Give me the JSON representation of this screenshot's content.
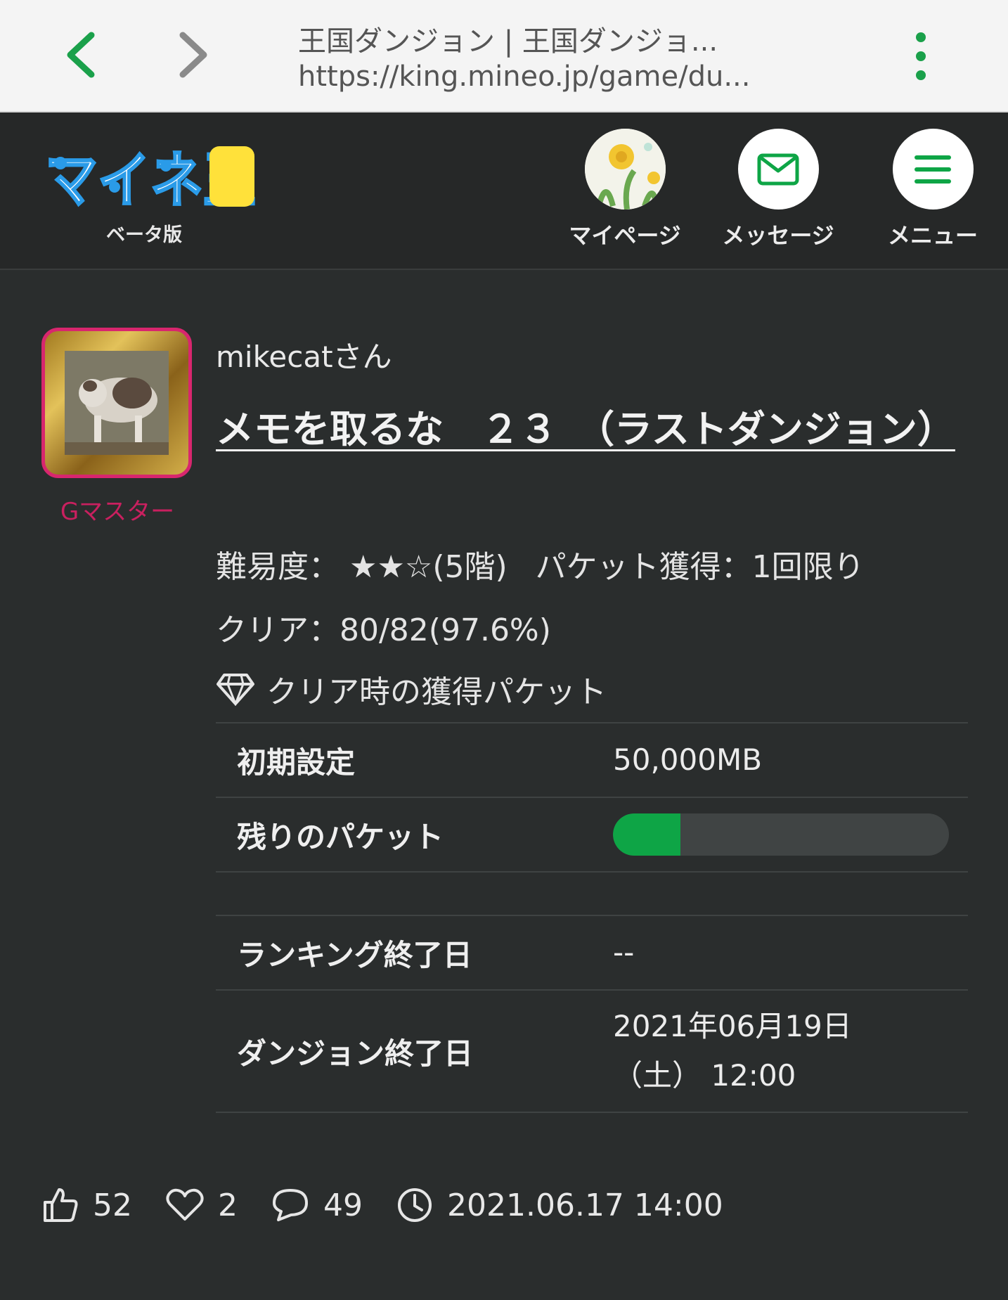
{
  "browser": {
    "page_title": "王国ダンジョン | 王国ダンジョ...",
    "url": "https://king.mineo.jp/game/du..."
  },
  "header": {
    "logo_text": "マイネ王",
    "beta_label": "ベータ版",
    "mypage_label": "マイページ",
    "message_label": "メッセージ",
    "menu_label": "メニュー"
  },
  "post": {
    "username": "mikecatさん",
    "rank": "Gマスター",
    "title": "メモを取るな　２３　（ラストダンジョン）",
    "difficulty_label": "難易度：",
    "difficulty_stars_filled": 2,
    "difficulty_stars_total": 3,
    "difficulty_suffix": "(5階)",
    "packet_gain": "パケット獲得：1回限り",
    "clear": "クリア：80/82(97.6%)",
    "packet_heading": "クリア時の獲得パケット"
  },
  "table": {
    "initial_label": "初期設定",
    "initial_value": "50,000MB",
    "remaining_label": "残りのパケット",
    "remaining_fraction": 0.2,
    "ranking_end_label": "ランキング終了日",
    "ranking_end_value": "--",
    "dungeon_end_label": "ダンジョン終了日",
    "dungeon_end_line1": "2021年06月19日",
    "dungeon_end_line2": "（土） 12:00"
  },
  "stats": {
    "likes": "52",
    "favorites": "2",
    "comments": "49",
    "datetime": "2021.06.17 14:00"
  },
  "colors": {
    "accent_green": "#0ea546",
    "rank_pink": "#c9205f"
  }
}
